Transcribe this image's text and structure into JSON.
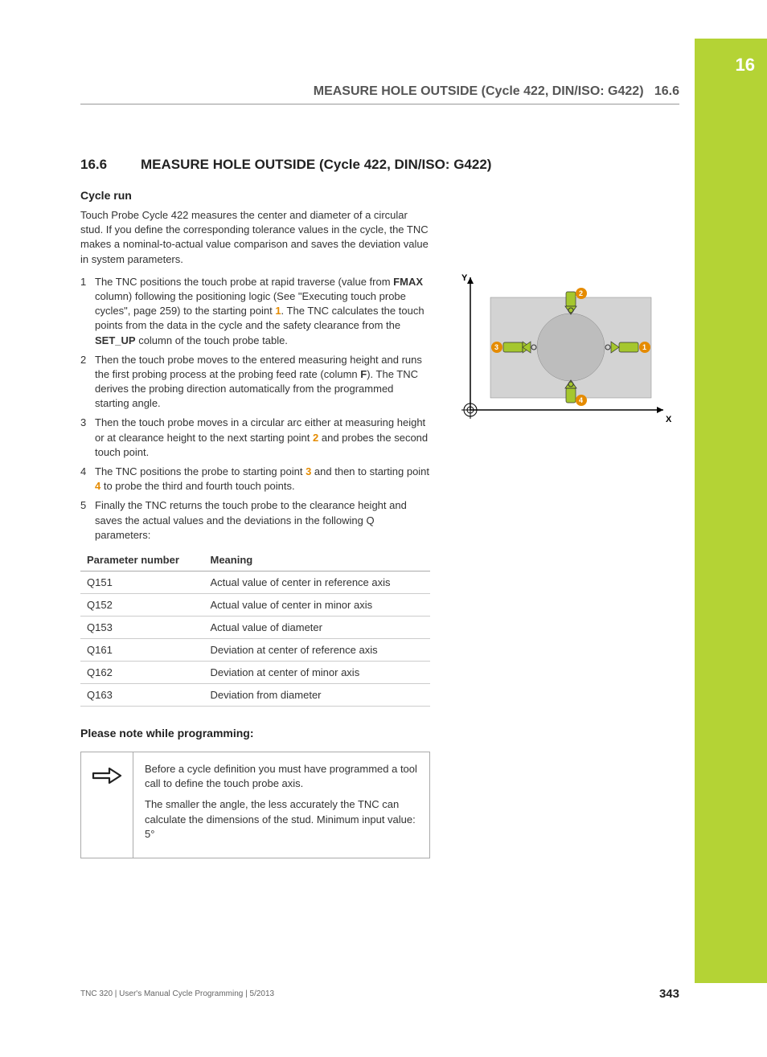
{
  "chapter_tab": "16",
  "header": {
    "title": "MEASURE HOLE OUTSIDE (Cycle 422, DIN/ISO: G422)",
    "section_ref": "16.6"
  },
  "heading": {
    "number": "16.6",
    "title": "MEASURE HOLE OUTSIDE (Cycle 422, DIN/ISO: G422)"
  },
  "cyclerun_heading": "Cycle run",
  "intro": "Touch Probe Cycle 422 measures the center and diameter of a circular stud. If you define the corresponding tolerance values in the cycle, the TNC makes a nominal-to-actual value comparison and saves the deviation value in system parameters.",
  "steps": [
    {
      "n": "1",
      "pre": "The TNC positions the touch probe at rapid traverse (value from ",
      "b1": "FMAX",
      "mid": " column) following the positioning logic (See \"Executing touch probe cycles\", page 259) to the starting point ",
      "pt": "1",
      "mid2": ". The TNC calculates the touch points from the data in the cycle and the safety clearance from the ",
      "b2": "SET_UP",
      "post": " column of the touch probe table."
    },
    {
      "n": "2",
      "pre": "Then the touch probe moves to the entered measuring height and runs the first probing process at the probing feed rate (column ",
      "b1": "F",
      "post": "). The TNC derives the probing direction automatically from the programmed starting angle."
    },
    {
      "n": "3",
      "pre": "Then the touch probe moves in a circular arc either at measuring height or at clearance height to the next starting point ",
      "pt": "2",
      "post": " and probes the second touch point."
    },
    {
      "n": "4",
      "pre": "The TNC positions the probe to starting point ",
      "pt": "3",
      "mid": " and then to starting point ",
      "pt2": "4",
      "post": " to probe the third and fourth touch points."
    },
    {
      "n": "5",
      "pre": "Finally the TNC returns the touch probe to the clearance height and saves the actual values and the deviations in the following Q parameters:"
    }
  ],
  "table": {
    "headers": [
      "Parameter number",
      "Meaning"
    ],
    "rows": [
      [
        "Q151",
        "Actual value of center in reference axis"
      ],
      [
        "Q152",
        "Actual value of center in minor axis"
      ],
      [
        "Q153",
        "Actual value of diameter"
      ],
      [
        "Q161",
        "Deviation at center of reference axis"
      ],
      [
        "Q162",
        "Deviation at center of minor axis"
      ],
      [
        "Q163",
        "Deviation from diameter"
      ]
    ]
  },
  "note_heading": "Please note while programming:",
  "note_paras": [
    "Before a cycle definition you must have programmed a tool call to define the touch probe axis.",
    "The smaller the angle, the less accurately the TNC can calculate the dimensions of the stud. Minimum input value: 5°"
  ],
  "diagram": {
    "x_label": "X",
    "y_label": "Y",
    "points": {
      "1": "1",
      "2": "2",
      "3": "3",
      "4": "4"
    }
  },
  "footer": {
    "left": "TNC 320 | User's Manual Cycle Programming | 5/2013",
    "page": "343"
  }
}
